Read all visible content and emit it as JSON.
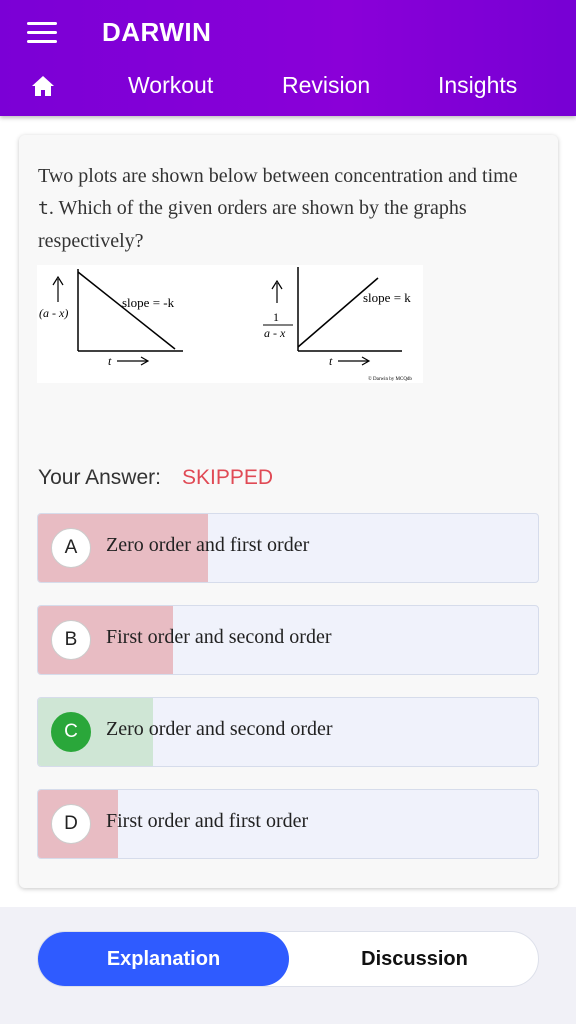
{
  "header": {
    "app_title": "DARWIN",
    "menu_icon": "hamburger-menu-icon",
    "home_icon": "home-icon",
    "nav": [
      "Workout",
      "Revision",
      "Insights"
    ],
    "background": "#7b00d6"
  },
  "question": {
    "text_before": "Two plots are shown below between concentration and time ",
    "text_code": "t",
    "text_after": ". Which of the given orders are shown by the graphs respectively?",
    "figure": {
      "left_y_label": "(a - x)",
      "left_slope": "slope = -k",
      "right_y_num": "1",
      "right_y_den": "a - x",
      "right_slope": "slope = k",
      "x_label": "t",
      "watermark": "© Darwin by MCQdb"
    }
  },
  "answer": {
    "label": "Your Answer:",
    "status": "SKIPPED",
    "status_color": "#e04a55"
  },
  "options": [
    {
      "letter": "A",
      "text": "Zero order and first order",
      "percent": 34,
      "state": "wrong"
    },
    {
      "letter": "B",
      "text": "First order and second order",
      "percent": 27,
      "state": "wrong"
    },
    {
      "letter": "C",
      "text": "Zero order and second order",
      "percent": 23,
      "state": "correct"
    },
    {
      "letter": "D",
      "text": "First order and first order",
      "percent": 16,
      "state": "wrong"
    }
  ],
  "colors": {
    "wrong_fill": "#e8bcc3",
    "correct_fill": "#cfe6d5",
    "accent": "#2f5bff"
  },
  "tabs": {
    "explanation": "Explanation",
    "discussion": "Discussion",
    "active": "Explanation"
  }
}
